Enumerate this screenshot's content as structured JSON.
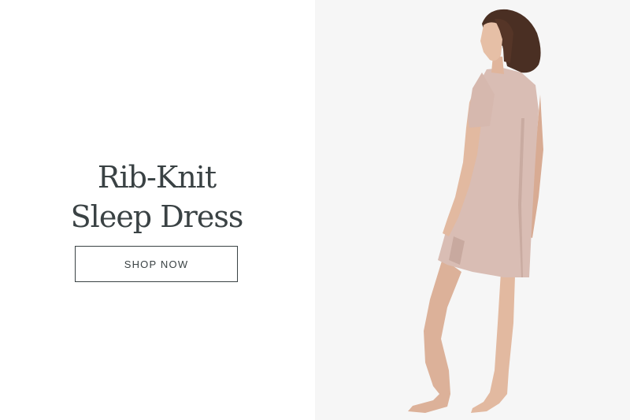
{
  "hero": {
    "headline_line1": "Rib-Knit",
    "headline_line2": "Sleep Dress",
    "cta_label": "SHOP NOW"
  },
  "colors": {
    "text": "#3a4244",
    "dress": "#d9bdb4",
    "skin": "#e2b9a0",
    "hair": "#4a2f23",
    "photo_background": "#f6f6f6"
  }
}
